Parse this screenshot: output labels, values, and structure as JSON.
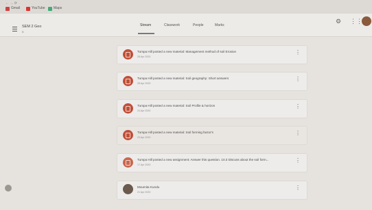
{
  "browser": {
    "bookmarks": [
      {
        "label": "Gmail",
        "color": "#c44"
      },
      {
        "label": "YouTube",
        "color": "#d33"
      },
      {
        "label": "Maps",
        "color": "#4a7"
      }
    ]
  },
  "header": {
    "course_name": "SEM 2 Geo",
    "course_sub": "B",
    "tabs": [
      {
        "label": "Stream"
      },
      {
        "label": "Classwork"
      },
      {
        "label": "People"
      },
      {
        "label": "Marks"
      }
    ]
  },
  "stream": {
    "items": [
      {
        "text": "Tumpa Hill posted a new material: Management method of soil Erosion",
        "date": "28 Apr 2020"
      },
      {
        "text": "Tumpa Hill posted a new material: Soil geography: Short answers",
        "date": "28 Apr 2020"
      },
      {
        "text": "Tumpa Hill posted a new material: Soil Profile & horizon",
        "date": "24 Apr 2020"
      },
      {
        "text": "Tumpa Hill posted a new material: Soil forming factor's",
        "date": "23 Apr 2020"
      },
      {
        "text": "Tumpa Hill posted a new assignment: Answer this question. 10.3 Discuss about the soil form...",
        "date": "17 Apr 2020"
      },
      {
        "text": "Moumita Kundu",
        "date": "21 Apr 2020"
      }
    ]
  },
  "icons": {
    "menu": "hamburger-menu-icon",
    "settings": "gear-icon",
    "apps": "apps-grid-icon",
    "material": "material-doc-icon",
    "more": "more-vert-icon"
  },
  "colors": {
    "accent": "#c0503a"
  }
}
